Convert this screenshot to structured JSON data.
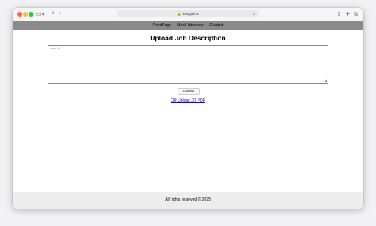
{
  "browser": {
    "url": "wingjob.ai",
    "sidebar_icon": "sidebar-icon",
    "back_icon": "‹",
    "forward_icon": "›",
    "translate_icon": "⌗",
    "reload_icon": "↻",
    "share_icon": "⇧",
    "new_tab_icon": "+",
    "tabs_icon": "⧉"
  },
  "nav": {
    "items": [
      "FrontPage",
      "Mock Interview",
      "Chatbot"
    ]
  },
  "main": {
    "title": "Upload Job Description",
    "textarea_placeholder": "Input JD",
    "continue_label": "Continue",
    "pdf_link": "OR Upload JD PDF"
  },
  "footer": {
    "text": "All rights reserved © 2023"
  },
  "colors": {
    "navbar": "#8a8a8a",
    "link": "#1a0dab",
    "footer": "#ededed"
  }
}
